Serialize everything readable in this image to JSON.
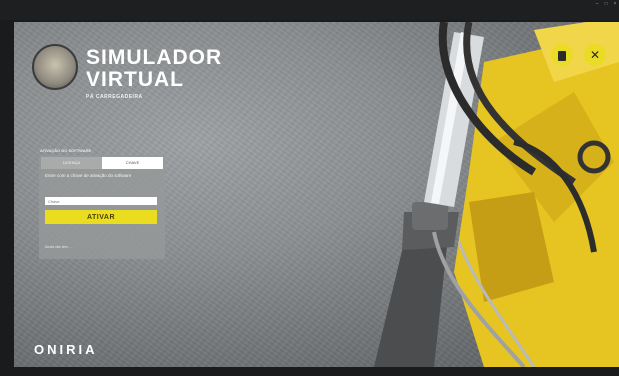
{
  "window": {
    "menu_tabs": [
      "",
      "",
      ""
    ],
    "right_status": ""
  },
  "header": {
    "title_line1": "SIMULADOR",
    "title_line2": "VIRTUAL",
    "subtitle": "PÁ CARREGADEIRA"
  },
  "activation": {
    "section_title": "ATIVAÇÃO DO SOFTWARE",
    "tab_left": "LICENÇA",
    "tab_right": "CHAVE",
    "instruction": "Entre com a chave de ativação do software",
    "key_placeholder": "Chave",
    "activate_label": "ATIVAR",
    "help_text": "Ainda não tem ..."
  },
  "brand": "ONIRIA",
  "colors": {
    "accent": "#eadc1f",
    "panel": "#96989a"
  },
  "icons": [
    "logo-icon",
    "document-icon",
    "close-icon"
  ]
}
